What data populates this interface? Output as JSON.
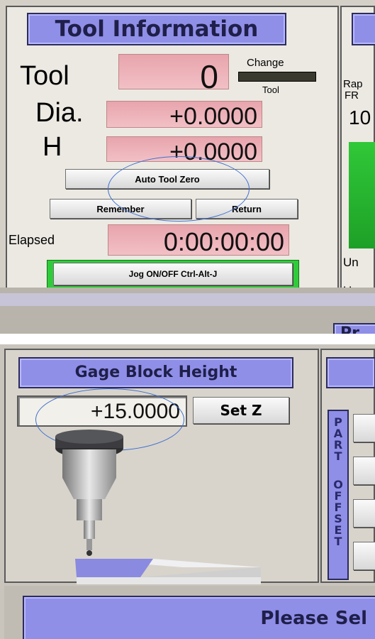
{
  "tool_info": {
    "title": "Tool Information",
    "tool_label": "Tool",
    "tool_value": "0",
    "change_label": "Change",
    "change_tool_label": "Tool",
    "dia_label": "Dia.",
    "dia_value": "+0.0000",
    "h_label": "H",
    "h_value": "+0.0000",
    "auto_tool_zero": "Auto Tool Zero",
    "remember": "Remember",
    "return": "Return",
    "elapsed_label": "Elapsed",
    "elapsed_value": "0:00:00:00",
    "jog_toggle": "Jog ON/OFF Ctrl-Alt-J"
  },
  "right_panel_partial": {
    "rapid_label": "Rap",
    "fr_label": "FR",
    "value_partial": "10",
    "un_label_1": "Un",
    "un_label_2": "Un",
    "bottom_partial": "Pr"
  },
  "gage_block": {
    "title": "Gage Block Height",
    "value": "+15.0000",
    "set_z": "Set Z"
  },
  "part_offset": {
    "vertical_label_1": "PART",
    "vertical_label_2": "OFFSET"
  },
  "bottom_banner": {
    "text": "Please Sel"
  },
  "colors": {
    "panel_bg": "#d4d0c8",
    "title_bg": "#8f8fe8",
    "dro_bg": "#efb0b8",
    "green": "#2fcc3a",
    "annotation_circle": "#3f6fd0"
  }
}
